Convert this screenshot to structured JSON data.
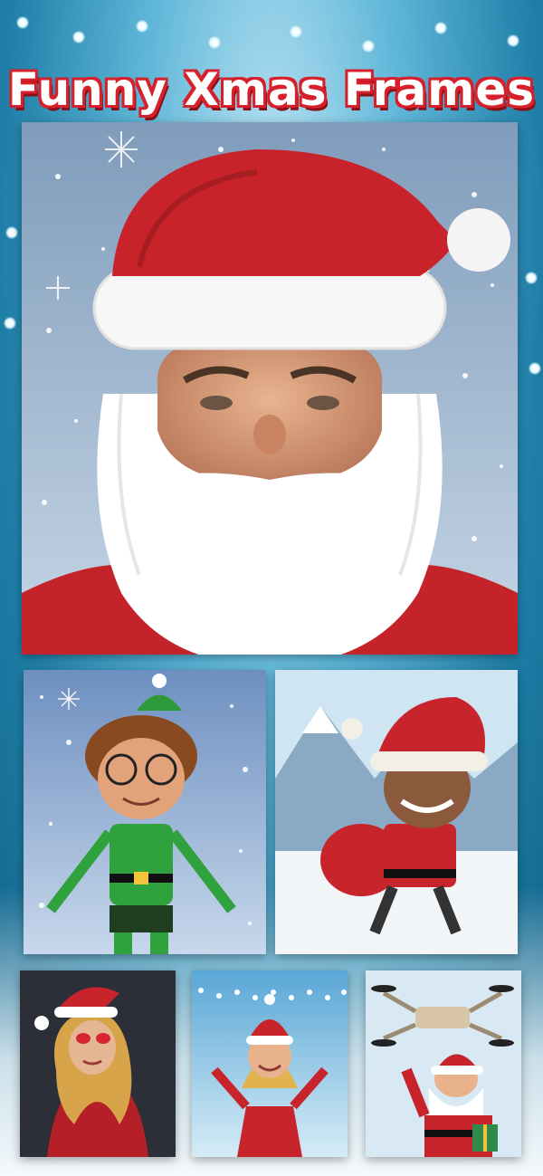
{
  "title": "Funny Xmas Frames",
  "colors": {
    "brand_red": "#d6202c",
    "sky_blue": "#5fb6d8"
  },
  "frames": [
    {
      "id": "santa-beard-frame",
      "subject": "santa-hat-and-beard"
    },
    {
      "id": "elf-frame",
      "subject": "elf-with-glasses"
    },
    {
      "id": "santa-boy-frame",
      "subject": "boy-santa-with-sack"
    },
    {
      "id": "santa-woman-frame",
      "subject": "woman-in-santa-hat"
    },
    {
      "id": "santa-girl-frame",
      "subject": "girl-in-santa-dress"
    },
    {
      "id": "drone-santa-frame",
      "subject": "santa-carried-by-drone"
    }
  ]
}
